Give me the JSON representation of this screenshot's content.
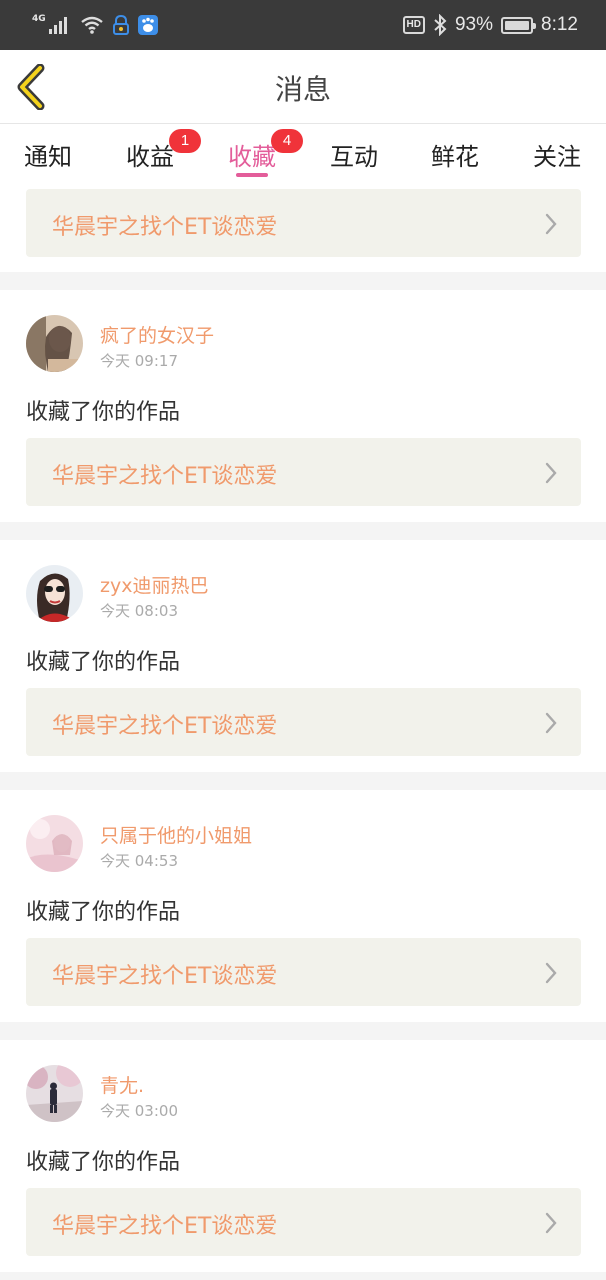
{
  "status_bar": {
    "network": "4G",
    "battery": "93%",
    "time": "8:12",
    "hd": "HD",
    "icons": [
      "signal-icon",
      "wifi-icon",
      "vpn-icon",
      "baidu-paw-icon",
      "bluetooth-icon",
      "battery-icon"
    ]
  },
  "header": {
    "title": "消息",
    "back_icon": "chevron-left-icon"
  },
  "tabs": [
    {
      "label": "通知",
      "badge": ""
    },
    {
      "label": "收益",
      "badge": "1"
    },
    {
      "label": "收藏",
      "badge": "4",
      "active": true
    },
    {
      "label": "互动",
      "badge": ""
    },
    {
      "label": "鲜花",
      "badge": ""
    },
    {
      "label": "关注",
      "badge": ""
    }
  ],
  "colors": {
    "accent": "#e35d9a",
    "name": "#f09a6c",
    "badge": "#f0333a",
    "work_bg": "#f2f2eb"
  },
  "first_card": {
    "work_title": "华晨宇之找个ET谈恋爱"
  },
  "items": [
    {
      "name": "疯了的女汉子",
      "time": "今天 09:17",
      "action": "收藏了你的作品",
      "work_title": "华晨宇之找个ET谈恋爱"
    },
    {
      "name": "zyx迪丽热巴",
      "time": "今天 08:03",
      "action": "收藏了你的作品",
      "work_title": "华晨宇之找个ET谈恋爱"
    },
    {
      "name": "只属于他的小姐姐",
      "time": "今天 04:53",
      "action": "收藏了你的作品",
      "work_title": "华晨宇之找个ET谈恋爱"
    },
    {
      "name": "青尢.",
      "time": "今天 03:00",
      "action": "收藏了你的作品",
      "work_title": "华晨宇之找个ET谈恋爱"
    }
  ]
}
